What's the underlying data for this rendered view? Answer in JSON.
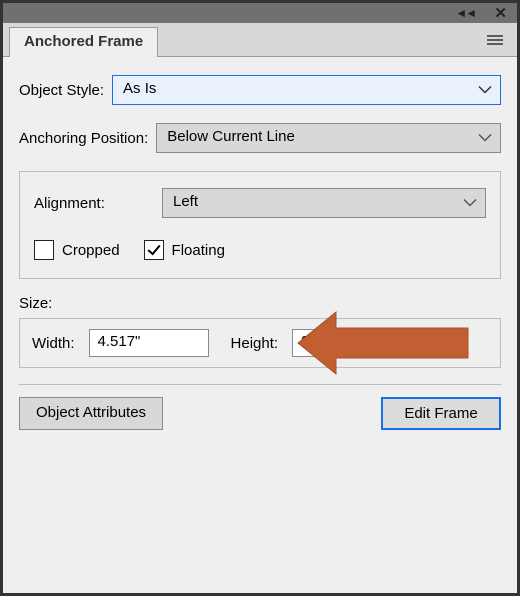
{
  "panel": {
    "title": "Anchored Frame"
  },
  "fields": {
    "objectStyleLabel": "Object Style:",
    "objectStyleValue": "As Is",
    "positionLabel": "Anchoring Position:",
    "positionValue": "Below Current Line",
    "alignmentLabel": "Alignment:",
    "alignmentValue": "Left",
    "croppedLabel": "Cropped",
    "croppedChecked": false,
    "floatingLabel": "Floating",
    "floatingChecked": true
  },
  "size": {
    "label": "Size:",
    "widthLabel": "Width:",
    "widthValue": "4.517\"",
    "heightLabel": "Height:",
    "heightValue": "2.084\""
  },
  "buttons": {
    "attributes": "Object Attributes",
    "edit": "Edit Frame"
  },
  "colors": {
    "arrow": "#c15f33"
  }
}
